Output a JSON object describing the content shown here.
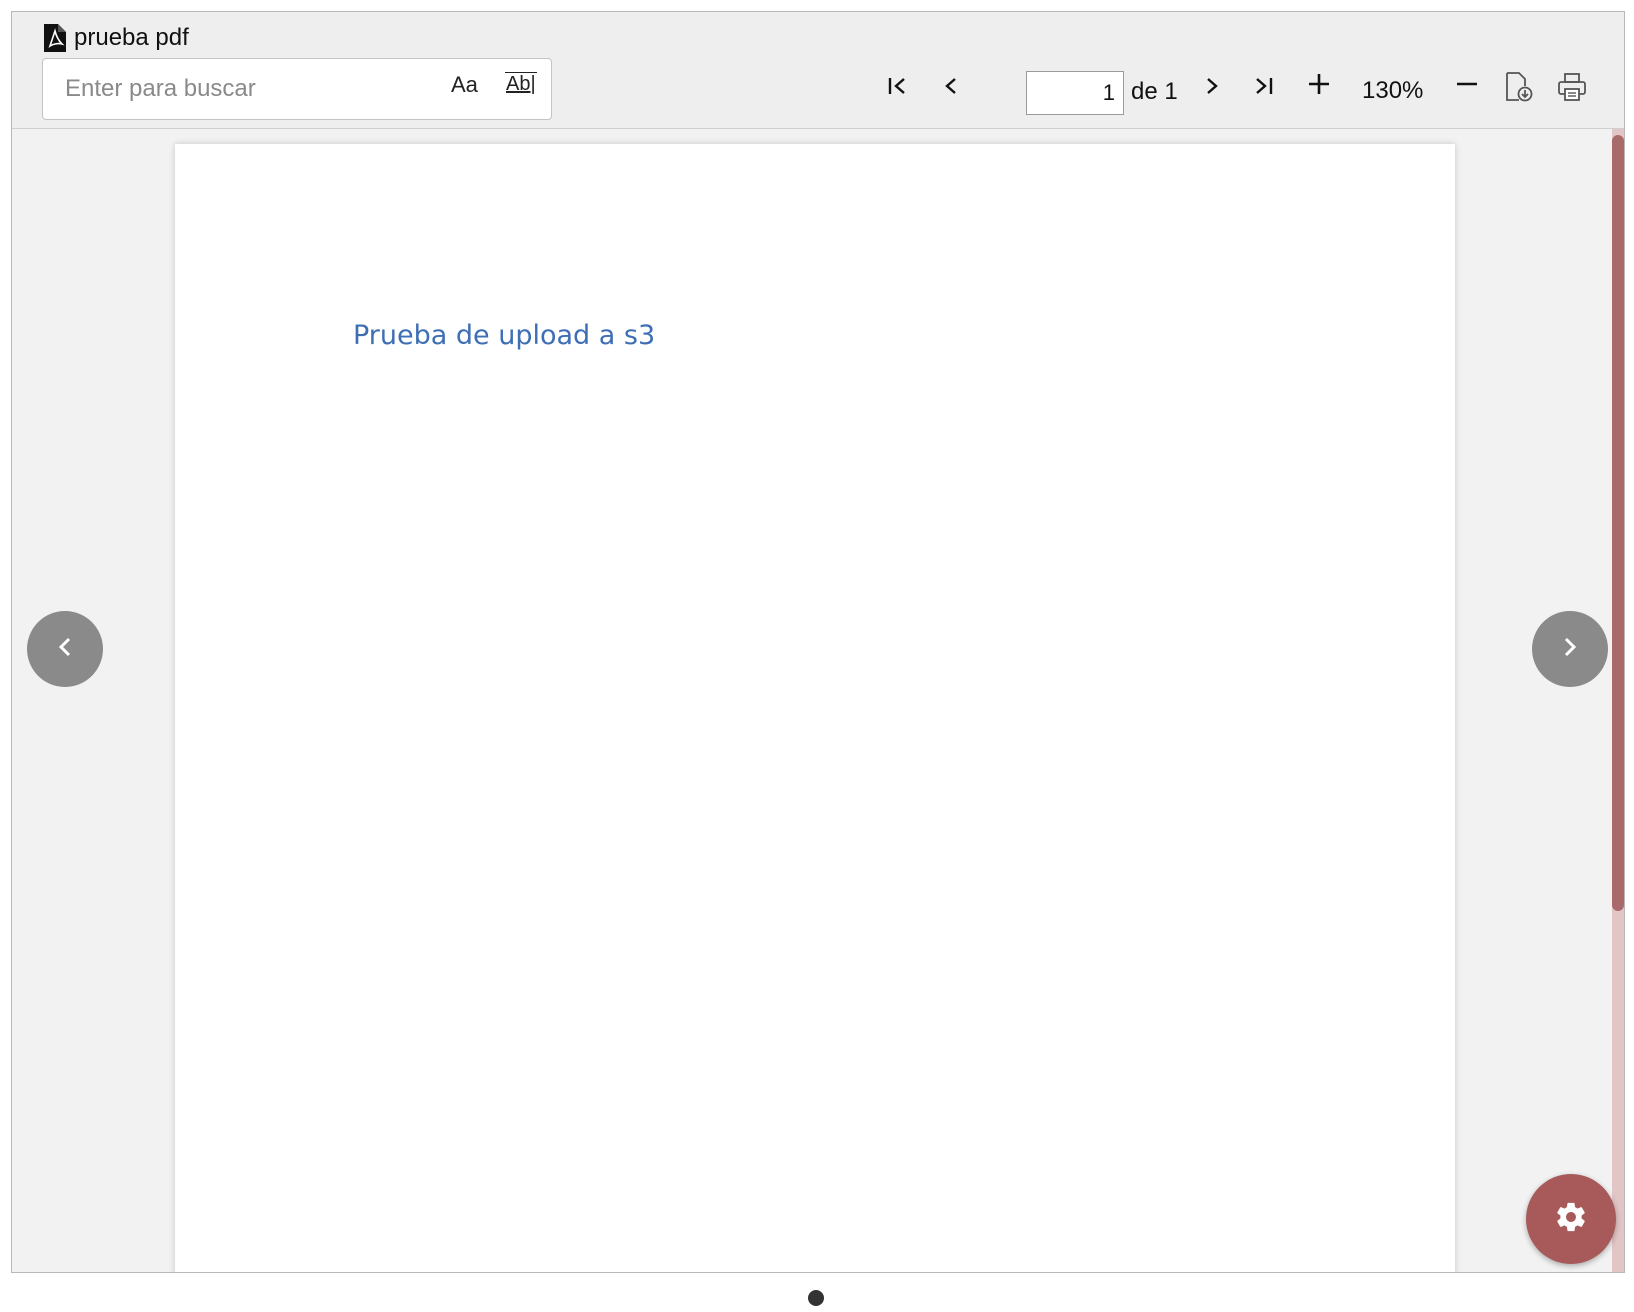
{
  "viewer": {
    "title": "prueba pdf",
    "search": {
      "placeholder": "Enter para buscar",
      "value": "",
      "match_case_label": "Aa",
      "whole_word_label": "Ab|"
    },
    "navigation": {
      "current_page": "1",
      "page_of_label": "de 1"
    },
    "zoom": {
      "level": "130%"
    },
    "icons": {
      "file": "pdf-file-icon",
      "first": "first-page-icon",
      "prev": "previous-page-icon",
      "next": "next-page-icon",
      "last": "last-page-icon",
      "zoom_in": "zoom-in-icon",
      "zoom_out": "zoom-out-icon",
      "download": "download-icon",
      "print": "print-icon",
      "settings": "gear-icon"
    }
  },
  "document": {
    "text": "Prueba de upload a s3"
  },
  "colors": {
    "accent": "#a85a5a",
    "scroll_thumb": "#a86a6a",
    "document_text": "#3e6fb4"
  }
}
